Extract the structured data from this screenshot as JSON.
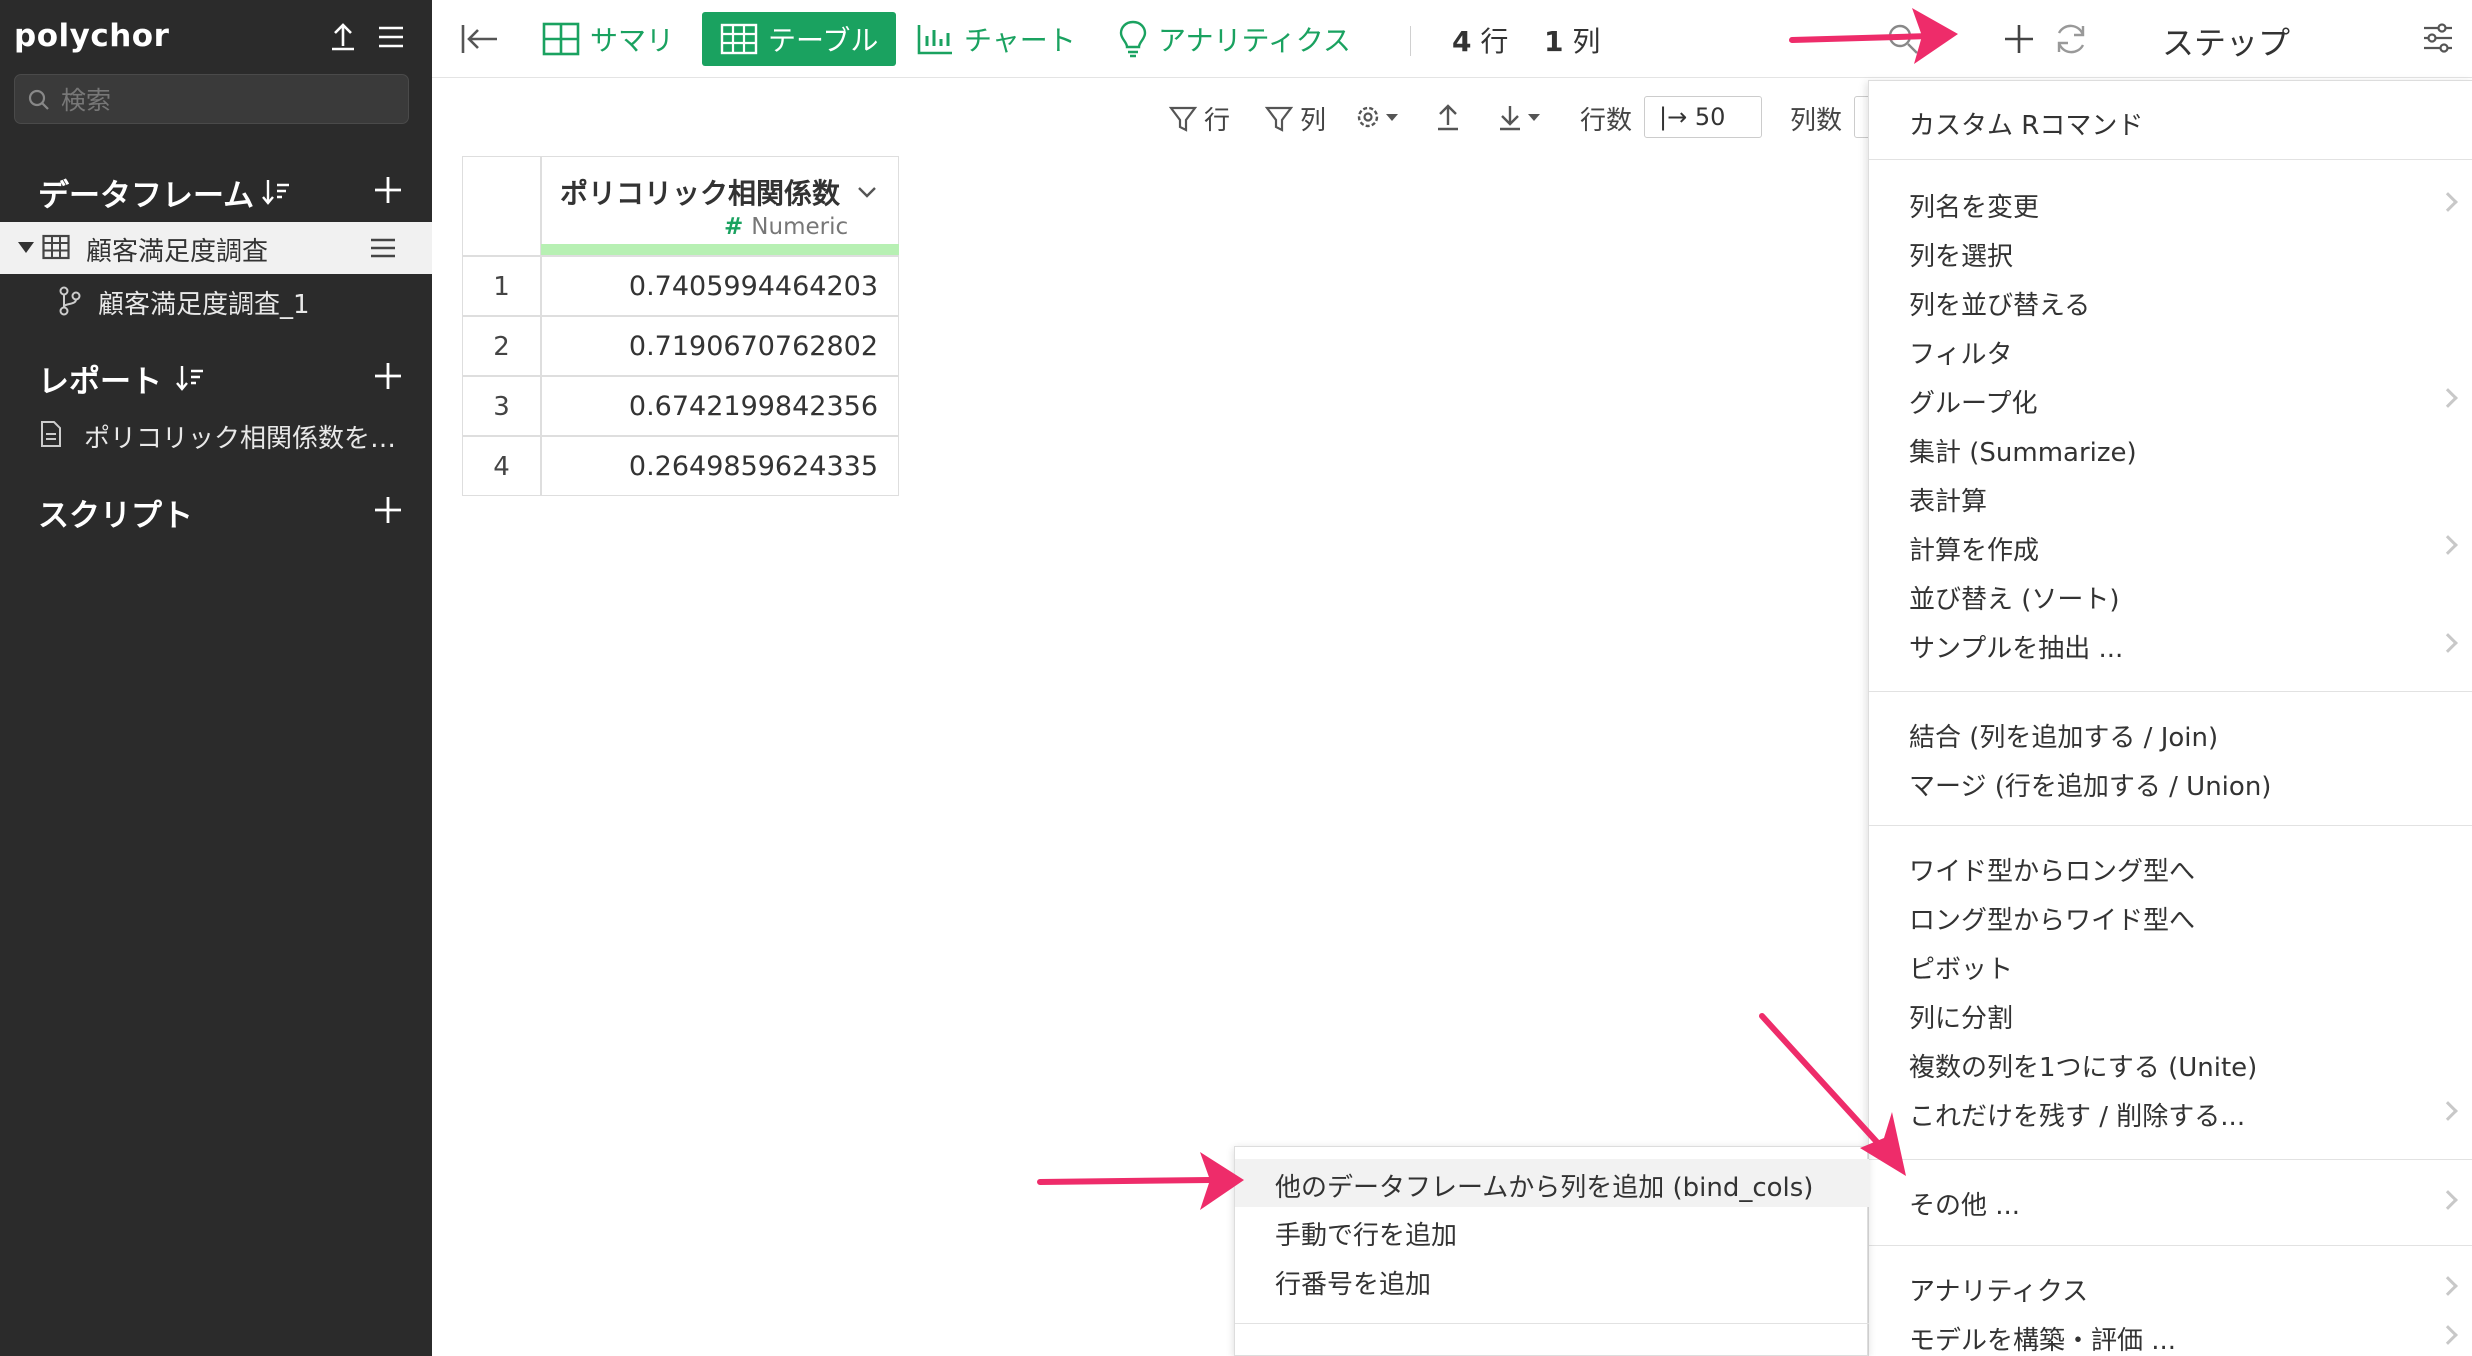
{
  "app": {
    "title": "polychor"
  },
  "sidebar": {
    "search_placeholder": "検索",
    "dataframes_label": "データフレーム",
    "dataframe_item": "顧客満足度調査",
    "branch_item": "顧客満足度調査_1",
    "reports_label": "レポート",
    "report_item": "ポリコリック相関係数を…",
    "scripts_label": "スクリプト"
  },
  "toolbar": {
    "summary": "サマリ",
    "table": "テーブル",
    "chart": "チャート",
    "analytics": "アナリティクス",
    "rows_count": "4",
    "rows_unit": "行",
    "cols_count": "1",
    "cols_unit": "列",
    "steps": "ステップ"
  },
  "subbar": {
    "filter_rows": "行",
    "filter_cols": "列",
    "rows_label": "行数",
    "rows_value": "|→ 50",
    "cols_label": "列数"
  },
  "table": {
    "column": {
      "name": "ポリコリック相関係数",
      "type": "Numeric"
    },
    "rows": [
      {
        "num": "1",
        "value": "0.7405994464203"
      },
      {
        "num": "2",
        "value": "0.7190670762802"
      },
      {
        "num": "3",
        "value": "0.6742199842356"
      },
      {
        "num": "4",
        "value": "0.2649859624335"
      }
    ]
  },
  "menu": {
    "custom_r": "カスタム Rコマンド",
    "rename": "列名を変更",
    "select": "列を選択",
    "reorder": "列を並び替える",
    "filter": "フィルタ",
    "group": "グループ化",
    "summarize": "集計 (Summarize)",
    "table_calc": "表計算",
    "create_calc": "計算を作成",
    "sort": "並び替え (ソート)",
    "sample": "サンプルを抽出 ...",
    "join": "結合 (列を追加する / Join)",
    "union": "マージ (行を追加する / Union)",
    "wide_to_long": "ワイド型からロング型へ",
    "long_to_wide": "ロング型からワイド型へ",
    "pivot": "ピボット",
    "split": "列に分割",
    "unite": "複数の列を1つにする (Unite)",
    "keep_remove": "これだけを残す / 削除する...",
    "other": "その他 ...",
    "analytics": "アナリティクス",
    "model": "モデルを構築・評価 ..."
  },
  "submenu": {
    "bind_cols": "他のデータフレームから列を追加 (bind_cols)",
    "add_rows": "手動で行を追加",
    "add_row_numbers": "行番号を追加"
  },
  "colors": {
    "accent": "#1aa260",
    "sidebar_bg": "#2b2b2b",
    "arrow": "#ee2c6a"
  }
}
